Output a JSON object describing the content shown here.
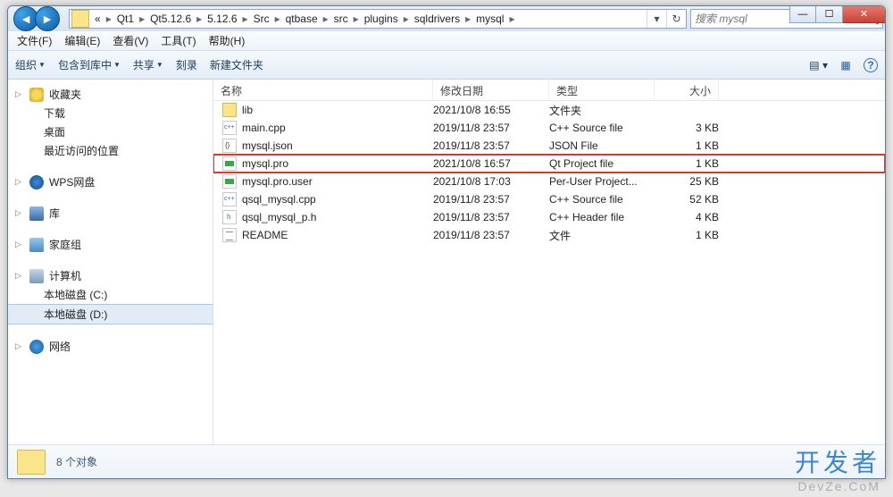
{
  "breadcrumbs": [
    "«",
    "Qt1",
    "Qt5.12.6",
    "5.12.6",
    "Src",
    "qtbase",
    "src",
    "plugins",
    "sqldrivers",
    "mysql"
  ],
  "search_placeholder": "搜索 mysql",
  "menu": {
    "file": "文件(F)",
    "edit": "编辑(E)",
    "view": "查看(V)",
    "tools": "工具(T)",
    "help": "帮助(H)"
  },
  "toolbar": {
    "organize": "组织",
    "include": "包含到库中",
    "share": "共享",
    "burn": "刻录",
    "newfolder": "新建文件夹"
  },
  "sidebar": {
    "fav": "收藏夹",
    "fav_items": {
      "downloads": "下载",
      "desktop": "桌面",
      "recent": "最近访问的位置"
    },
    "wps": "WPS网盘",
    "lib": "库",
    "home": "家庭组",
    "computer": "计算机",
    "computer_items": {
      "c": "本地磁盘 (C:)",
      "d": "本地磁盘 (D:)"
    },
    "network": "网络"
  },
  "columns": {
    "name": "名称",
    "date": "修改日期",
    "type": "类型",
    "size": "大小"
  },
  "files": [
    {
      "name": "lib",
      "date": "2021/10/8 16:55",
      "type": "文件夹",
      "size": "",
      "icon": "folder",
      "hl": false
    },
    {
      "name": "main.cpp",
      "date": "2019/11/8 23:57",
      "type": "C++ Source file",
      "size": "3 KB",
      "icon": "cpp",
      "hl": false
    },
    {
      "name": "mysql.json",
      "date": "2019/11/8 23:57",
      "type": "JSON File",
      "size": "1 KB",
      "icon": "json",
      "hl": false
    },
    {
      "name": "mysql.pro",
      "date": "2021/10/8 16:57",
      "type": "Qt Project file",
      "size": "1 KB",
      "icon": "pro",
      "hl": true
    },
    {
      "name": "mysql.pro.user",
      "date": "2021/10/8 17:03",
      "type": "Per-User Project...",
      "size": "25 KB",
      "icon": "pro",
      "hl": false
    },
    {
      "name": "qsql_mysql.cpp",
      "date": "2019/11/8 23:57",
      "type": "C++ Source file",
      "size": "52 KB",
      "icon": "cpp",
      "hl": false
    },
    {
      "name": "qsql_mysql_p.h",
      "date": "2019/11/8 23:57",
      "type": "C++ Header file",
      "size": "4 KB",
      "icon": "h",
      "hl": false
    },
    {
      "name": "README",
      "date": "2019/11/8 23:57",
      "type": "文件",
      "size": "1 KB",
      "icon": "txt",
      "hl": false
    }
  ],
  "status": "8 个对象",
  "watermark": {
    "zh": "开发者",
    "en": "DevZe.CoM"
  }
}
